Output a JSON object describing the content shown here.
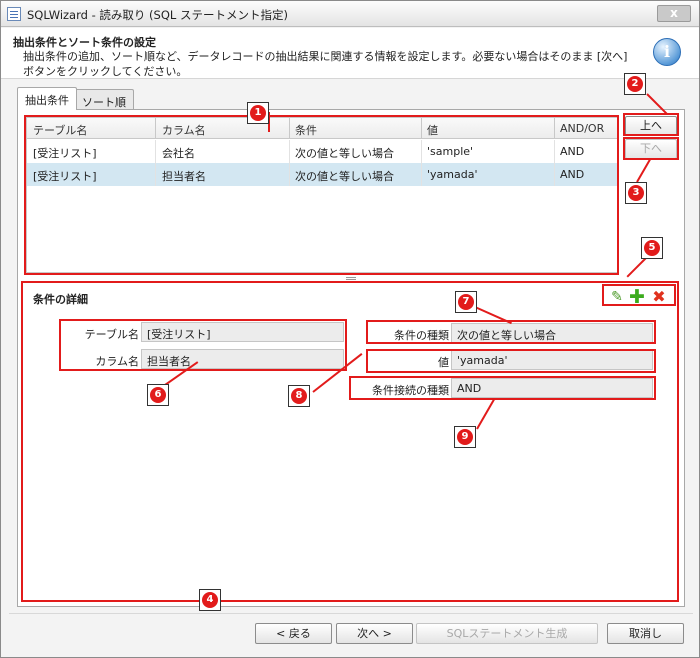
{
  "window": {
    "title": "SQLWizard - 読み取り (SQL ステートメント指定)",
    "close": "x"
  },
  "header": {
    "title": "抽出条件とソート条件の設定",
    "description": "抽出条件の追加、ソート順など、データレコードの抽出結果に関連する情報を設定します。必要ない場合はそのまま [次へ] ボタンをクリックしてください。",
    "info_glyph": "i"
  },
  "tabs": [
    {
      "label": "抽出条件"
    },
    {
      "label": "ソート順"
    }
  ],
  "grid": {
    "columns": [
      "テーブル名",
      "カラム名",
      "条件",
      "値",
      "AND/OR"
    ],
    "rows": [
      {
        "table": "[受注リスト]",
        "column": "会社名",
        "condition": "次の値と等しい場合",
        "value": "'sample'",
        "andor": "AND"
      },
      {
        "table": "[受注リスト]",
        "column": "担当者名",
        "condition": "次の値と等しい場合",
        "value": "'yamada'",
        "andor": "AND"
      }
    ]
  },
  "side_buttons": {
    "up": "上へ",
    "down": "下へ"
  },
  "details": {
    "title": "条件の詳細",
    "table_label": "テーブル名",
    "table_value": "[受注リスト]",
    "column_label": "カラム名",
    "column_value": "担当者名",
    "cond_type_label": "条件の種類",
    "cond_type_value": "次の値と等しい場合",
    "value_label": "値",
    "value_value": "'yamada'",
    "join_label": "条件接続の種類",
    "join_value": "AND",
    "edit_glyph": "✎",
    "add_glyph": "✚",
    "delete_glyph": "✖"
  },
  "markers": [
    "1",
    "2",
    "3",
    "4",
    "5",
    "6",
    "7",
    "8",
    "9"
  ],
  "footer": {
    "back": "< 戻る",
    "next": "次へ >",
    "generate": "SQLステートメント生成",
    "cancel": "取消し"
  },
  "colors": {
    "annotation": "#e21b1b",
    "selected_row": "#d3e7f2"
  }
}
